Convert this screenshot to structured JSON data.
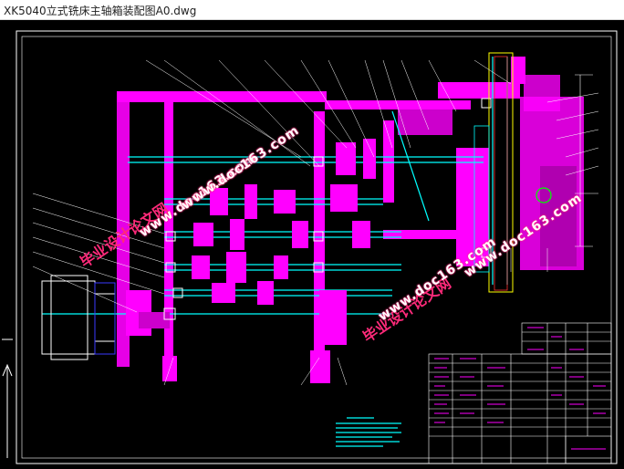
{
  "window": {
    "title": "XK5040立式铣床主轴箱装配图A0.dwg"
  },
  "watermark": {
    "cn": "毕业设计论文网",
    "url": "www.doc163.com",
    "color": "#ff2a7a"
  },
  "drawing": {
    "background": "#000000",
    "colors": {
      "magenta": "#ff00ff",
      "cyan": "#00ffff",
      "white": "#ffffff",
      "yellow": "#ffff00",
      "green": "#00ff00",
      "red": "#ff3030",
      "blue": "#3a3aff"
    }
  }
}
